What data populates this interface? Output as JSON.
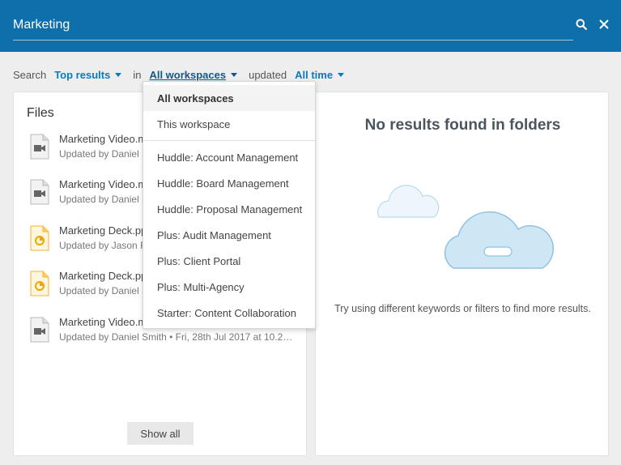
{
  "header": {
    "search_value": "Marketing",
    "search_icon": "search-icon",
    "close_icon": "close-icon",
    "background": "#0f6fab"
  },
  "filters": {
    "search_label": "Search",
    "results_value": "Top results",
    "in_label": "in",
    "workspace_value": "All workspaces",
    "updated_label": "updated",
    "time_value": "All time",
    "accent": "#0a7bc1"
  },
  "files": {
    "title": "Files",
    "items": [
      {
        "name": "Marketing Video.m",
        "meta": "Updated by Daniel S",
        "icon": "video-file-icon"
      },
      {
        "name": "Marketing Video.m",
        "meta": "Updated by Daniel S",
        "icon": "video-file-icon"
      },
      {
        "name": "Marketing Deck.pp",
        "meta": "Updated by Jason F",
        "icon": "presentation-file-icon"
      },
      {
        "name": "Marketing Deck.pp",
        "meta": "Updated by Daniel S",
        "icon": "presentation-file-icon"
      },
      {
        "name": "Marketing Video.m",
        "meta": "Updated by Daniel Smith • Fri, 28th Jul 2017 at 10.2…",
        "icon": "video-file-icon"
      }
    ],
    "show_all_label": "Show all"
  },
  "folders": {
    "no_results": "No results found in folders",
    "hint": "Try using different keywords or filters to find more results.",
    "illustration": "clouds-illustration"
  },
  "workspace_dropdown": {
    "options": [
      "All workspaces",
      "This workspace",
      "Huddle: Account Management",
      "Huddle: Board Management",
      "Huddle: Proposal Management",
      "Plus: Audit Management",
      "Plus: Client Portal",
      "Plus: Multi-Agency",
      "Starter: Content Collaboration"
    ],
    "selected": "All workspaces"
  }
}
